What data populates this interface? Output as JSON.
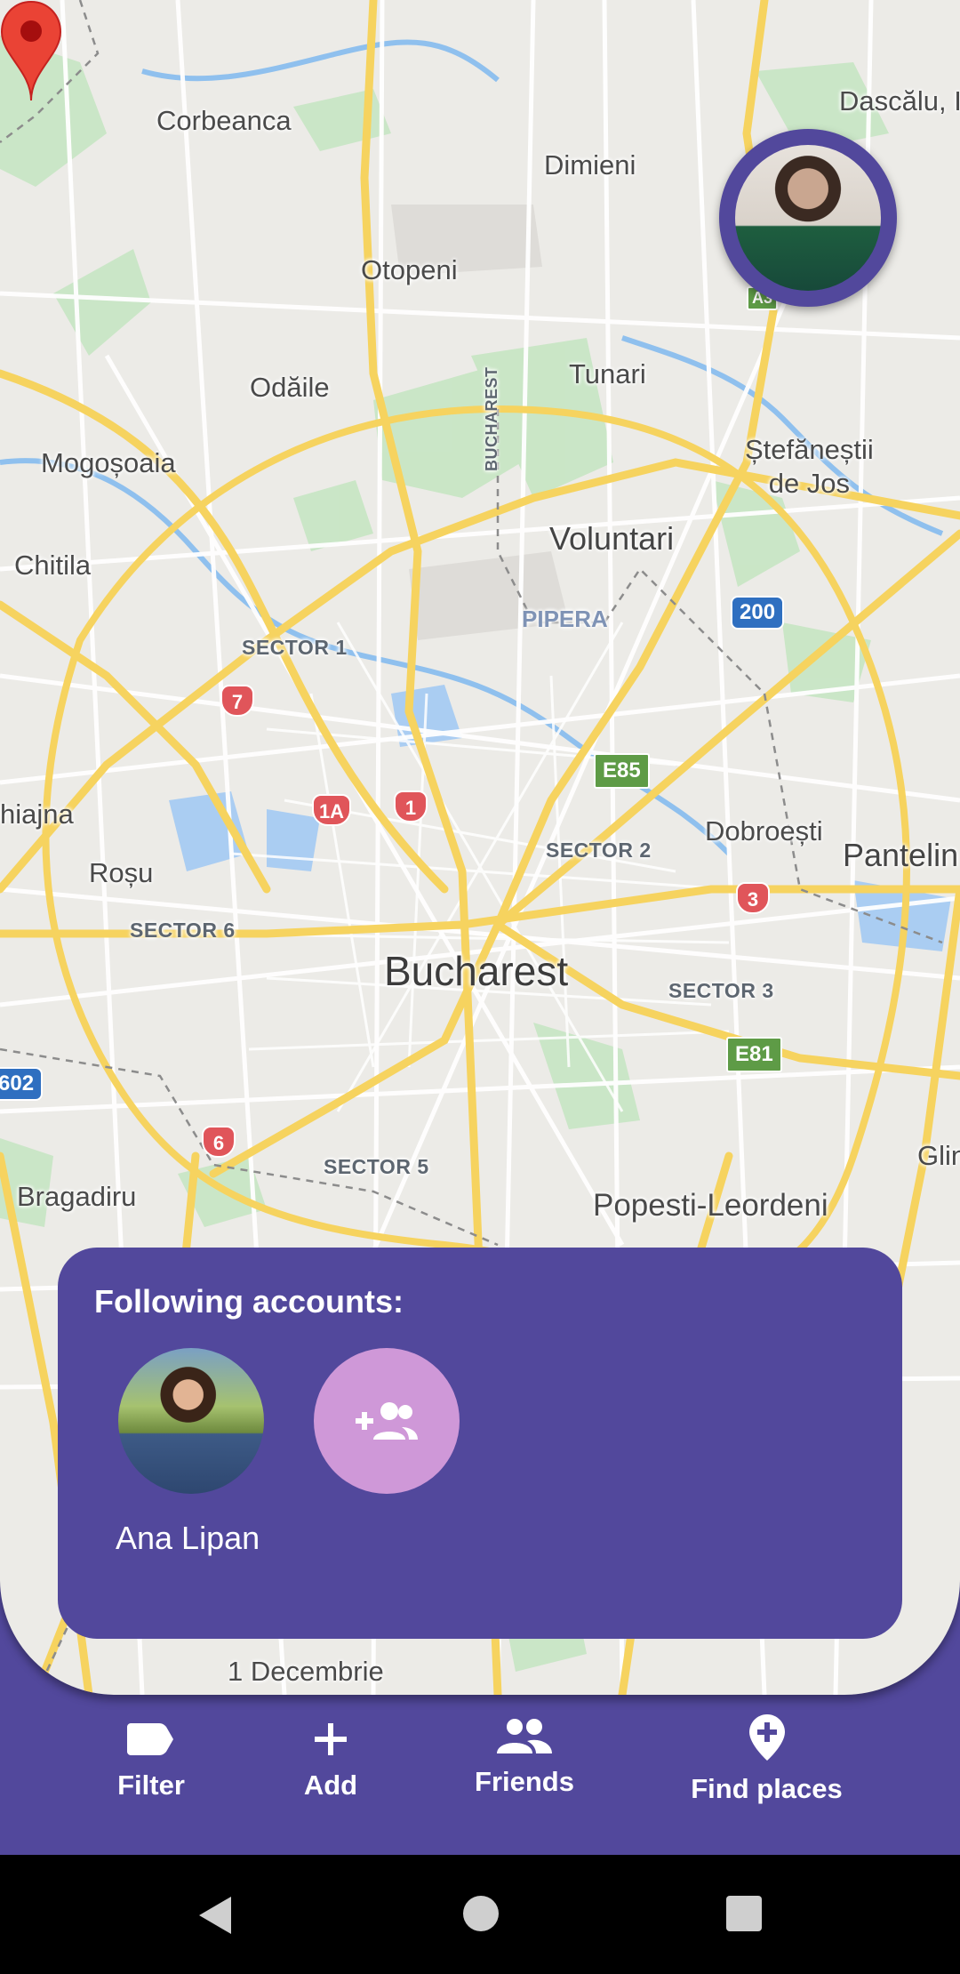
{
  "map": {
    "places": {
      "corbeanca": "Corbeanca",
      "dascalu": "Dascălu, I",
      "dimieni": "Dimieni",
      "otopeni": "Otopeni",
      "tunari": "Tunari",
      "odaile": "Odăile",
      "mogosoaia": "Mogoșoaia",
      "stefanestii": "Ștefăneștii\nde Jos",
      "voluntari": "Voluntari",
      "chitila": "Chitila",
      "pipera": "PIPERA",
      "sector1": "SECTOR 1",
      "sector2": "SECTOR 2",
      "sector3": "SECTOR 3",
      "sector5": "SECTOR 5",
      "sector6": "SECTOR 6",
      "chiajna": "hiajna",
      "rosu": "Roșu",
      "dobroesti": "Dobroești",
      "pantelimon": "Pantelin",
      "bucharest": "Bucharest",
      "glina": "Glin",
      "bragadiru": "Bragadiru",
      "popesti": "Popesti-Leordeni",
      "decembrie": "1 Decembrie",
      "bucharest_road": "BUCHAREST"
    },
    "route_badges": {
      "r7": "7",
      "r1a": "1A",
      "r1": "1",
      "r3": "3",
      "r6": "6",
      "e85": "E85",
      "e81": "E81",
      "r200": "200",
      "r602": "602",
      "a3": "A3"
    }
  },
  "following": {
    "title": "Following accounts:",
    "accounts": [
      {
        "name": "Ana Lipan"
      }
    ],
    "add_button_icon": "add-friend-icon"
  },
  "nav": {
    "items": [
      {
        "label": "Filter",
        "icon": "label-tag-icon"
      },
      {
        "label": "Add",
        "icon": "plus-icon"
      },
      {
        "label": "Friends",
        "icon": "people-icon"
      },
      {
        "label": "Find places",
        "icon": "add-location-icon"
      }
    ]
  },
  "colors": {
    "accent": "#52489c",
    "add_friend": "#cf98d8",
    "pin": "#ea4335"
  }
}
